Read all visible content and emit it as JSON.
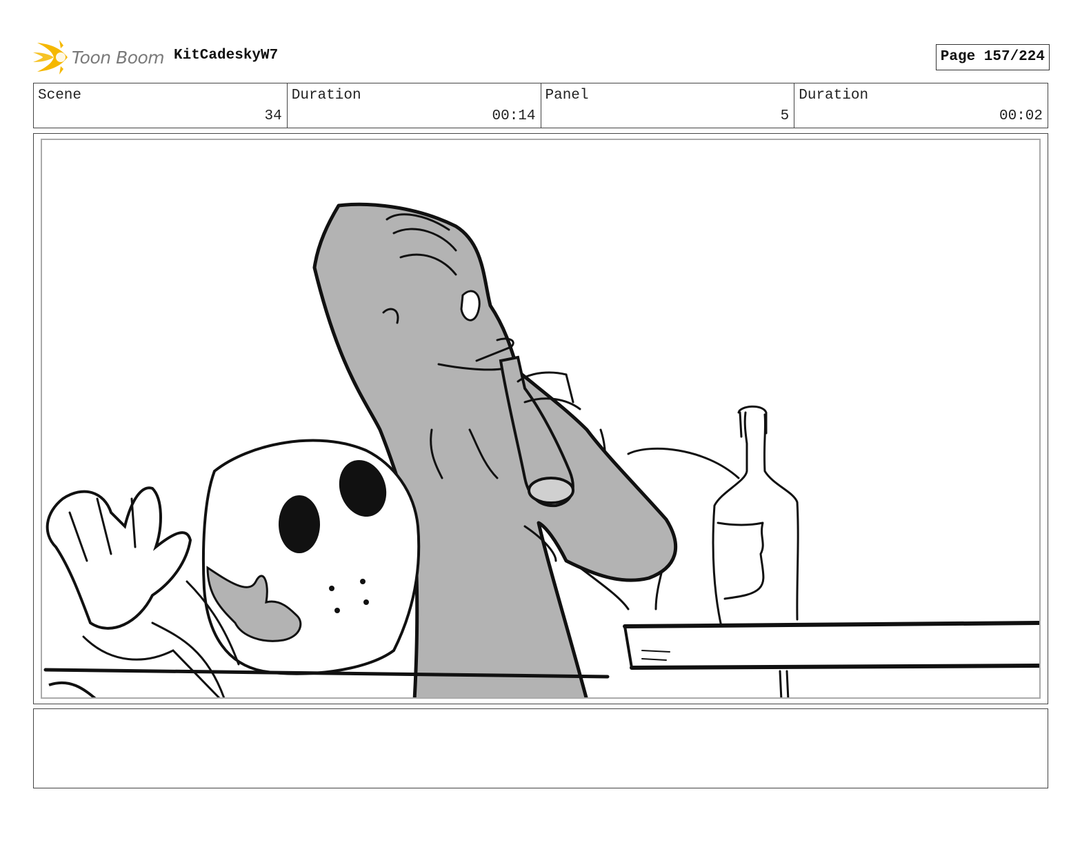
{
  "header": {
    "logo_text": "Toon Boom",
    "project_name": "KitCadeskyW7",
    "page_label": "Page 157/224"
  },
  "info": {
    "scene_label": "Scene",
    "scene_value": "34",
    "scene_duration_label": "Duration",
    "scene_duration_value": "00:14",
    "panel_label": "Panel",
    "panel_value": "5",
    "panel_duration_label": "Duration",
    "panel_duration_value": "00:02"
  },
  "colors": {
    "shade": "#b3b3b3",
    "ink": "#111111",
    "logo_flame": "#f5b800"
  },
  "notes": {
    "text": ""
  }
}
